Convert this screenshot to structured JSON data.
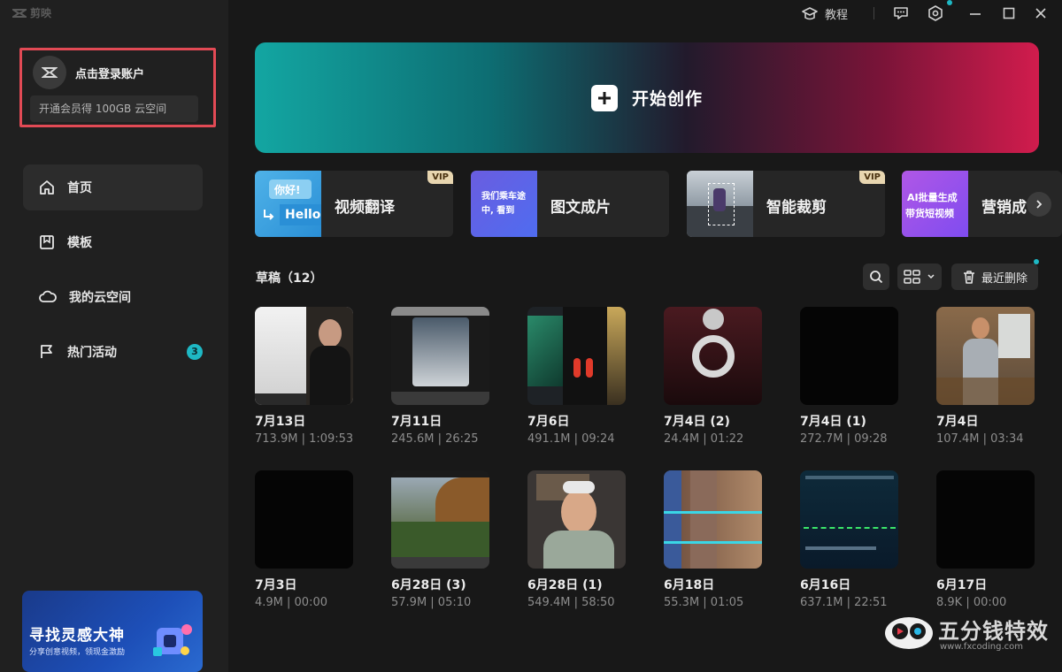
{
  "app": {
    "name": "剪映"
  },
  "account": {
    "login_label": "点击登录账户",
    "member_promo": "开通会员得 100GB 云空间"
  },
  "sidebar": {
    "items": [
      {
        "label": "首页",
        "icon": "home-icon"
      },
      {
        "label": "模板",
        "icon": "template-icon"
      },
      {
        "label": "我的云空间",
        "icon": "cloud-icon"
      },
      {
        "label": "热门活动",
        "icon": "flag-icon",
        "badge": "3"
      }
    ],
    "promo": {
      "title": "寻找灵感大神",
      "subtitle": "分享创意视频，领现金激励"
    }
  },
  "topbar": {
    "tutorial_label": "教程"
  },
  "hero": {
    "label": "开始创作"
  },
  "features": [
    {
      "label": "视频翻译",
      "vip": "VIP",
      "thumb_line1": "你好!",
      "thumb_line2": "Hello"
    },
    {
      "label": "图文成片",
      "vip": "",
      "thumb_line1": "我们乘车途",
      "thumb_line2": "中, 看到"
    },
    {
      "label": "智能裁剪",
      "vip": "VIP"
    },
    {
      "label": "营销成",
      "vip": "",
      "thumb_line1": "AI批量生成",
      "thumb_line2": "带货短视频"
    }
  ],
  "drafts": {
    "title": "草稿（12）",
    "recent_delete_label": "最近删除",
    "items": [
      {
        "title": "7月13日",
        "meta": "713.9M | 1:09:53"
      },
      {
        "title": "7月11日",
        "meta": "245.6M | 26:25"
      },
      {
        "title": "7月6日",
        "meta": "491.1M | 09:24"
      },
      {
        "title": "7月4日 (2)",
        "meta": "24.4M | 01:22"
      },
      {
        "title": "7月4日 (1)",
        "meta": "272.7M | 09:28"
      },
      {
        "title": "7月4日",
        "meta": "107.4M | 03:34"
      },
      {
        "title": "7月3日",
        "meta": "4.9M | 00:00"
      },
      {
        "title": "6月28日 (3)",
        "meta": "57.9M | 05:10"
      },
      {
        "title": "6月28日 (1)",
        "meta": "549.4M | 58:50"
      },
      {
        "title": "6月18日",
        "meta": "55.3M | 01:05"
      },
      {
        "title": "6月16日",
        "meta": "637.1M | 22:51"
      },
      {
        "title": "6月17日",
        "meta": "8.9K | 00:00"
      }
    ]
  },
  "watermark": {
    "text": "五分钱特效",
    "url": "www.fxcoding.com"
  },
  "colors": {
    "accent": "#1eb8c4",
    "highlight_border": "#e24a55",
    "background": "#181818",
    "sidebar": "#202020"
  }
}
